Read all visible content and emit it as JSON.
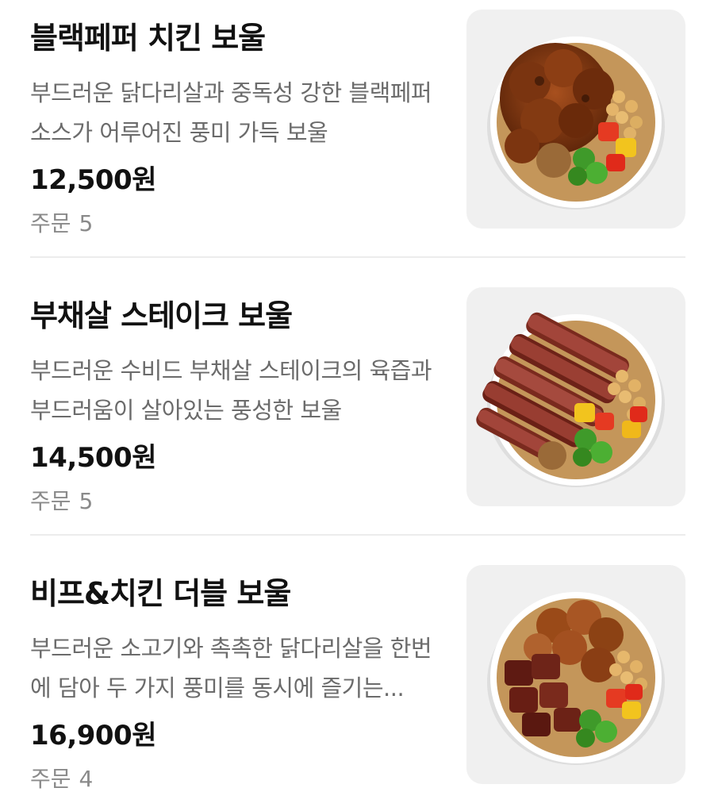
{
  "menu": {
    "items": [
      {
        "title": "블랙페퍼 치킨 보울",
        "description": "부드러운 닭다리살과 중독성 강한 블랙페퍼 소스가 어루어진 풍미 가득 보울",
        "price": "12,500원",
        "orders_label": "주문",
        "orders_count": "5",
        "image_icon": "chicken-bowl-image"
      },
      {
        "title": "부채살 스테이크 보울",
        "description": "부드러운 수비드 부채살 스테이크의 육즙과 부드러움이 살아있는 풍성한 보울",
        "price": "14,500원",
        "orders_label": "주문",
        "orders_count": "5",
        "image_icon": "steak-bowl-image"
      },
      {
        "title": "비프&치킨 더블 보울",
        "description": "부드러운 소고기와 촉촉한 닭다리살을 한번에 담아 두 가지 풍미를 동시에 즐기는...",
        "price": "16,900원",
        "orders_label": "주문",
        "orders_count": "4",
        "image_icon": "beef-chicken-bowl-image"
      }
    ]
  },
  "colors": {
    "title": "#111111",
    "description": "#6b6b6b",
    "orders": "#8a8a8a",
    "thumb_bg": "#f0f0f0",
    "divider": "#ececec"
  }
}
